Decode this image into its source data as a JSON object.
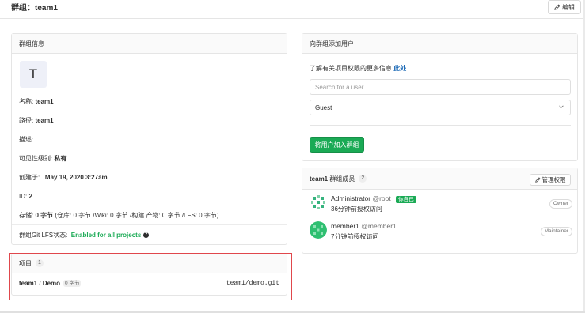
{
  "page": {
    "title": "群组：team1"
  },
  "toolbar": {
    "edit_label": "编辑"
  },
  "group_info": {
    "header": "群组信息",
    "avatar_letter": "T",
    "name_label": "名称:",
    "name_value": "team1",
    "path_label": "路径:",
    "path_value": "team1",
    "desc_label": "描述:",
    "visibility_label": "可见性级别:",
    "visibility_value": "私有",
    "created_label": "创建于:",
    "created_value": "May 19, 2020 3:27am",
    "id_label": "ID:",
    "id_value": "2",
    "storage_label": "存储:",
    "storage_value": "0 字节",
    "storage_detail": "(仓库: 0 字节 /Wiki: 0 字节 /构建 产物: 0 字节 /LFS: 0 字节)",
    "lfs_label": "群组Git LFS状态:",
    "lfs_value": "Enabled for all projects",
    "help_glyph": "?"
  },
  "projects": {
    "header": "项目",
    "count": "1",
    "items": [
      {
        "name": "team1 / Demo",
        "size": "0 字节",
        "path": "team1/demo.git"
      }
    ]
  },
  "add_user": {
    "header": "向群组添加用户",
    "info_text": "了解有关项目权限的更多信息",
    "info_link": "此处",
    "search_placeholder": "Search for a user",
    "role_value": "Guest",
    "submit_label": "将用户加入群组"
  },
  "members": {
    "group_name": "team1",
    "header_suffix": "群组成员",
    "count": "2",
    "manage_label": "管理权限",
    "items": [
      {
        "name": "Administrator",
        "username": "@root",
        "you_badge": "你自己",
        "granted": "36分钟前授权访问",
        "role": "Owner"
      },
      {
        "name": "member1",
        "username": "@member1",
        "granted": "7分钟前授权访问",
        "role": "Maintainer"
      }
    ]
  },
  "colors": {
    "accent_green": "#1aaa55",
    "link_blue": "#1b69b6",
    "highlight_red": "#e0474c"
  },
  "icons": {
    "edit": "pencil-icon",
    "manage": "pencil-icon",
    "dropdown": "chevron-down-icon",
    "help": "question-circle-icon"
  }
}
